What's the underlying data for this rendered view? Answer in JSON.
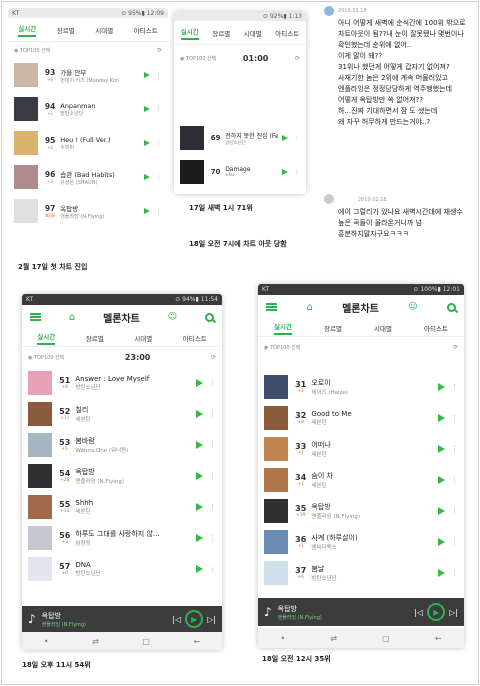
{
  "tabs": [
    "실시간",
    "장르별",
    "시대별",
    "아티스트"
  ],
  "top100": "TOP100 선택",
  "p1": {
    "status_left": "KT",
    "status_right": "⊙ 95%▮ 12:09",
    "time": "",
    "rows": [
      {
        "rank": "93",
        "chg": "+6",
        "title": "가을 안부",
        "artist": "먼데이 키즈 (Monday Kiz)",
        "c": "#c9b8a6"
      },
      {
        "rank": "94",
        "chg": "+1",
        "title": "Anpanman",
        "artist": "방탄소년단",
        "c": "#3a3a44"
      },
      {
        "rank": "95",
        "chg": "+2",
        "title": "Heu ! (Full Ver.)",
        "artist": "수퍼비",
        "c": "#d9b56e"
      },
      {
        "rank": "96",
        "chg": "+2",
        "title": "습관 (Bad Habits)",
        "artist": "유성은 (SHAUN)",
        "c": "#b08b8b"
      },
      {
        "rank": "97",
        "chg": "NEW",
        "title": "옥탑방",
        "artist": "엔플라잉 (N.Flying)",
        "c": "#e0e0e0"
      }
    ],
    "caption": "2월 17일 첫 차트 진입"
  },
  "p2": {
    "status_left": "",
    "status_right": "⊙ 92%▮ 1:13",
    "time": "01:00",
    "rows": [
      {
        "rank": "69",
        "chg": "",
        "title": "전하지 못한 진심 (Feat. St...",
        "artist": "방탄소년단",
        "c": "#2e2e38"
      },
      {
        "rank": "70",
        "chg": "",
        "title": "Damage",
        "artist": "EXO",
        "c": "#1c1c1c"
      },
      {
        "rank": "71",
        "chg": "+26",
        "title": "옥탑방",
        "artist": "엔플라잉 (N.Flying)",
        "c": "#e8e8e8"
      }
    ],
    "caption1": "17일 새벽 1시 71위",
    "caption2": "18일 오전 7시에 차트 아웃 당함"
  },
  "chat": {
    "date1": "2019.02.18",
    "msg1": [
      "아니 어떻게 새벽에 순식간에 100위 밖으로",
      "차트아웃이 됨??내 눈이 잘못됐나 몇번이나",
      "확인했는데 순위에 없어..",
      "이게 말이 돼??",
      "31위나 했던게 어떻게 갑자기 없어져?",
      "사재기한 놈은 2위에 계속 머물러있고",
      "엔플라잉은 정정당당하게 역주행했는데",
      "어떻게 옥탑방만 쏙 없어져??",
      "하...진짜 기대하면서 잠 도 샜는데",
      "왜 자꾸 허무하게 만드는거야..?"
    ],
    "date2": "2019.02.18",
    "msg2": [
      "에이 그럴리가 있나요 새벽시간대에 재생수",
      "높은 곡들이 올라온거니까 넘",
      "흥분하지말자구요ㅋㅋㅋ"
    ]
  },
  "p3": {
    "status_left": "KT",
    "status_right": "⊙ 94%▮ 11:54",
    "app_title": "멜론차트",
    "time": "23:00",
    "rows": [
      {
        "rank": "51",
        "chg": "+8",
        "title": "Answer : Love Myself",
        "artist": "방탄소년단",
        "c": "#e8a2b8"
      },
      {
        "rank": "52",
        "chg": "+11",
        "title": "칠리",
        "artist": "세븐틴",
        "c": "#8c5a3c"
      },
      {
        "rank": "53",
        "chg": "+1",
        "title": "봄바람",
        "artist": "Wanna One (워너원)",
        "c": "#a7b7c2"
      },
      {
        "rank": "54",
        "chg": "+28",
        "title": "옥탑방",
        "artist": "엔플라잉 (N.Flying)",
        "c": "#303030"
      },
      {
        "rank": "55",
        "chg": "+13",
        "title": "Shhh",
        "artist": "세븐틴",
        "c": "#9e6a4a"
      },
      {
        "rank": "56",
        "chg": "+3",
        "title": "하루도 그대를 사랑하지 않...",
        "artist": "임창정",
        "c": "#c7c7cf"
      },
      {
        "rank": "57",
        "chg": "+8",
        "title": "DNA",
        "artist": "방탄소년단",
        "c": "#e5e5ef"
      }
    ],
    "player_title": "옥탑방",
    "player_artist": "엔플라잉 (N.Flying)",
    "caption": "18일 오후 11시 54위"
  },
  "p4": {
    "status_left": "KT",
    "status_right": "⊙ 100%▮ 12:01",
    "app_title": "멜론차트",
    "rows": [
      {
        "rank": "31",
        "chg": "+1",
        "title": "오로이",
        "artist": "헤이즈 (Heize)",
        "c": "#3f4c6b"
      },
      {
        "rank": "32",
        "chg": "+8",
        "title": "Good to Me",
        "artist": "세븐틴",
        "c": "#8c5a3c"
      },
      {
        "rank": "33",
        "chg": "+1",
        "title": "어떠나",
        "artist": "세븐틴",
        "c": "#c08550"
      },
      {
        "rank": "34",
        "chg": "+1",
        "title": "숨이 차",
        "artist": "세븐틴",
        "c": "#b0784c"
      },
      {
        "rank": "35",
        "chg": "+19",
        "title": "옥탑방",
        "artist": "엔플라잉 (N.Flying)",
        "c": "#303030"
      },
      {
        "rank": "36",
        "chg": "+1",
        "title": "사계 (하루살이)",
        "artist": "엠씨더맥스",
        "c": "#6a8bb4"
      },
      {
        "rank": "37",
        "chg": "+6",
        "title": "봄날",
        "artist": "방탄소년단",
        "c": "#cfe0ea"
      }
    ],
    "player_title": "옥탑방",
    "player_artist": "엔플라잉 (N.Flying)",
    "caption": "18일 오전 12시 35위"
  },
  "colors": {
    "accent": "#2bb24c",
    "change": "#e76f1a"
  }
}
